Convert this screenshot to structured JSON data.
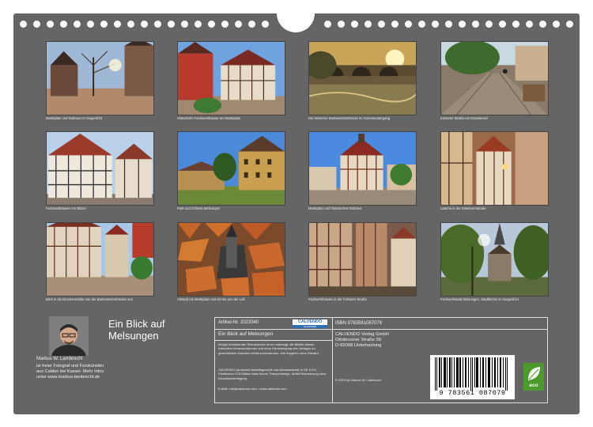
{
  "photos": [
    {
      "caption": "Marktplatz und Rathaus im Gegenlicht"
    },
    {
      "caption": "Historische Fachwerkhäuser am Marktplatz"
    },
    {
      "caption": "Die steinerne Bartenwetzerbrücke im Sonnenuntergang"
    },
    {
      "caption": "Kasseler Straße mit Gänseliesel"
    },
    {
      "caption": "Fachwerkhäuser Am Bitzen"
    },
    {
      "caption": "Park und Schloss Melsungen"
    },
    {
      "caption": "Marktplatz und historisches Rathaus"
    },
    {
      "caption": "Laterne in der Eisenturmstraße"
    },
    {
      "caption": "Blick in die Brückenstraße von der Bartenwetzerbrücke aus"
    },
    {
      "caption": "Altstadt mit Marktplatz und Kirche aus der Luft"
    },
    {
      "caption": "Fachwerkhäuser in der Fritzlarer Straße"
    },
    {
      "caption": "Fachwerkstadt Melsungen, Stadtkirche im Gegenlicht"
    }
  ],
  "calendar": {
    "title_line1": "Ein Blick auf",
    "title_line2": "Melsungen"
  },
  "author": {
    "name": "Markus W. Lambrecht",
    "bio": "ist freier Fotograf und Fotokünstler aus Calden bei Kassel. Mehr Infos unter www.markus-lambrecht.de"
  },
  "info": {
    "article_no": "Artikel-Nr. 2023340",
    "logo_text": "CALVENDO",
    "logo_sub": "KALENDER",
    "product_title": "Ein Blick auf Melsungen",
    "legal_1": "Infolge bestehender Schutzrechte ist es untersagt, die Blätter dieses Kalenders herauszutrennen und ohne Genehmigung des Verlages zu gewerblichen Zwecken weiterzuverwenden. Alle Angaben ohne Gewähr.",
    "legal_2": "CALVENDO produziert bedarfsgerecht und klimaberwusst in DE & EU. Positiveres CO2-Bilanz dank kurzer Transportwege, Abfall-Reduzierung dank Einzelstückfertigung.",
    "contact": "E-Mail: info@calvendo.com • www.calvendo.com",
    "isbn": "ISBN 9783561087079",
    "publisher_1": "CALVENDO Verlag GmbH",
    "publisher_2": "Ottobrunner Straße 39",
    "publisher_3": "D-82008 Unterhaching",
    "copyright": "© 2023 by Markus W. Lambrecht",
    "barcode_digits": "9 783561 087079",
    "eco_label": "eco"
  },
  "colors": {
    "sheet": "#656565",
    "eco_green": "#4a9a2c",
    "calvendo_blue": "#2b6fb5"
  }
}
